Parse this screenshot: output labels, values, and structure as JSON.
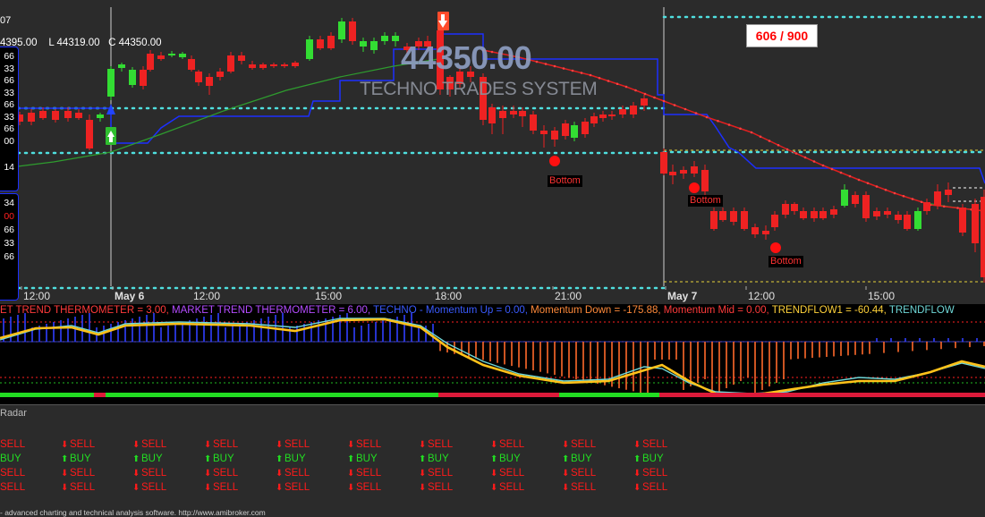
{
  "chart": {
    "corner_id": "07",
    "ohlc": {
      "h": "4395.00",
      "l": "L 44319.00",
      "c": "C 44350.00"
    },
    "big_price": "44350.00",
    "system_name": "TECHNO TRADES SYSTEM",
    "counter": "606 / 900",
    "bottom_label": "Bottom",
    "x_labels": [
      {
        "text": "12:00",
        "bold": false
      },
      {
        "text": "May 6",
        "bold": true
      },
      {
        "text": "12:00",
        "bold": false
      },
      {
        "text": "15:00",
        "bold": false
      },
      {
        "text": "18:00",
        "bold": false
      },
      {
        "text": "21:00",
        "bold": false
      },
      {
        "text": "May 7",
        "bold": true
      },
      {
        "text": "12:00",
        "bold": false
      },
      {
        "text": "15:00",
        "bold": false
      }
    ],
    "sidebar_values": [
      "66",
      "33",
      "66",
      "33",
      "66",
      "33",
      "66",
      "00",
      "14"
    ],
    "sidebar2_values": [
      {
        "t": "34",
        "c": "#ffffff"
      },
      {
        "t": "00",
        "c": "#ff2020"
      },
      {
        "t": "66",
        "c": "#ffffff"
      },
      {
        "t": "33",
        "c": "#ffffff"
      },
      {
        "t": "66",
        "c": "#ffffff"
      }
    ],
    "colors": {
      "up_candle": "#33dd33",
      "down_candle": "#ee2222",
      "blue_line": "#1c2fff",
      "red_line": "#e02020",
      "green_line": "#2e9c2e",
      "level_line": "#4fdfdf"
    }
  },
  "indicator": {
    "title_parts": [
      {
        "t": "ET TREND THERMOMETER = 3.00, ",
        "c": "#ff3b3b"
      },
      {
        "t": "MARKET TREND THERMOMETER = 6.00, ",
        "c": "#b44cff"
      },
      {
        "t": "TECHNO - Momentum Up = 0.00, ",
        "c": "#3a5bff"
      },
      {
        "t": "Momentum Down = -175.88, ",
        "c": "#ff8a3a"
      },
      {
        "t": "Momentum Mid = 0.00, ",
        "c": "#ff3b3b"
      },
      {
        "t": "TRENDFLOW1 = -60.44, ",
        "c": "#ffd23a"
      },
      {
        "t": "TRENDFLOW",
        "c": "#6fd8d8"
      }
    ]
  },
  "radar": {
    "title": "Radar",
    "columns": [
      [
        "SELL",
        "BUY",
        "SELL",
        "SELL"
      ],
      [
        "SELL",
        "BUY",
        "SELL",
        "SELL"
      ],
      [
        "SELL",
        "BUY",
        "SELL",
        "SELL"
      ],
      [
        "SELL",
        "BUY",
        "SELL",
        "SELL"
      ],
      [
        "SELL",
        "BUY",
        "SELL",
        "SELL"
      ],
      [
        "SELL",
        "BUY",
        "SELL",
        "SELL"
      ],
      [
        "SELL",
        "BUY",
        "SELL",
        "SELL"
      ],
      [
        "SELL",
        "BUY",
        "SELL",
        "SELL"
      ],
      [
        "SELL",
        "BUY",
        "SELL",
        "SELL"
      ],
      [
        "SELL",
        "BUY",
        "SELL",
        "SELL"
      ]
    ],
    "footer": "- advanced charting and technical analysis software. http://www.amibroker.com"
  }
}
